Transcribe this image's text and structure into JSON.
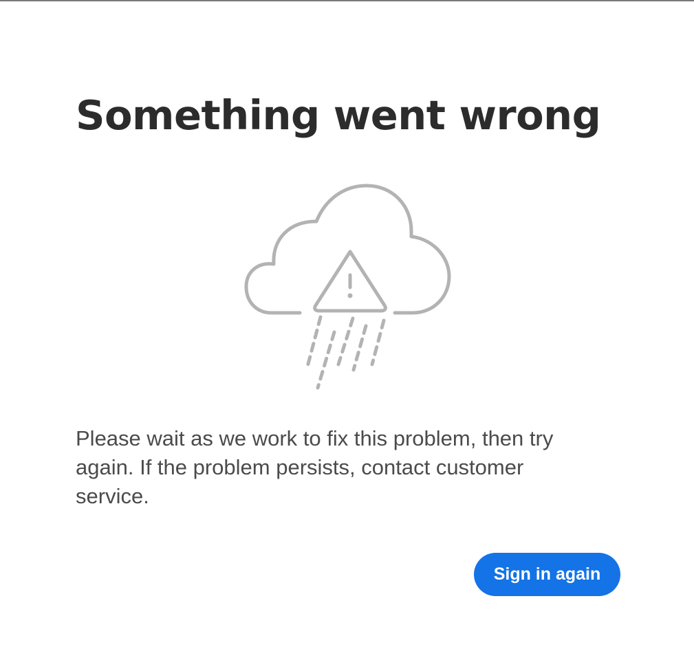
{
  "error": {
    "title": "Something went wrong",
    "message": "Please wait as we work to fix this problem, then try again. If the problem persists, contact customer service.",
    "illustration_icon": "cloud-warning-rain-icon"
  },
  "actions": {
    "sign_in_again_label": "Sign in again"
  },
  "colors": {
    "title": "#2c2c2c",
    "body_text": "#4b4b4b",
    "illustration_stroke": "#b3b3b3",
    "button_bg": "#1473e6",
    "button_text": "#ffffff",
    "top_border": "#7a7a7a"
  }
}
